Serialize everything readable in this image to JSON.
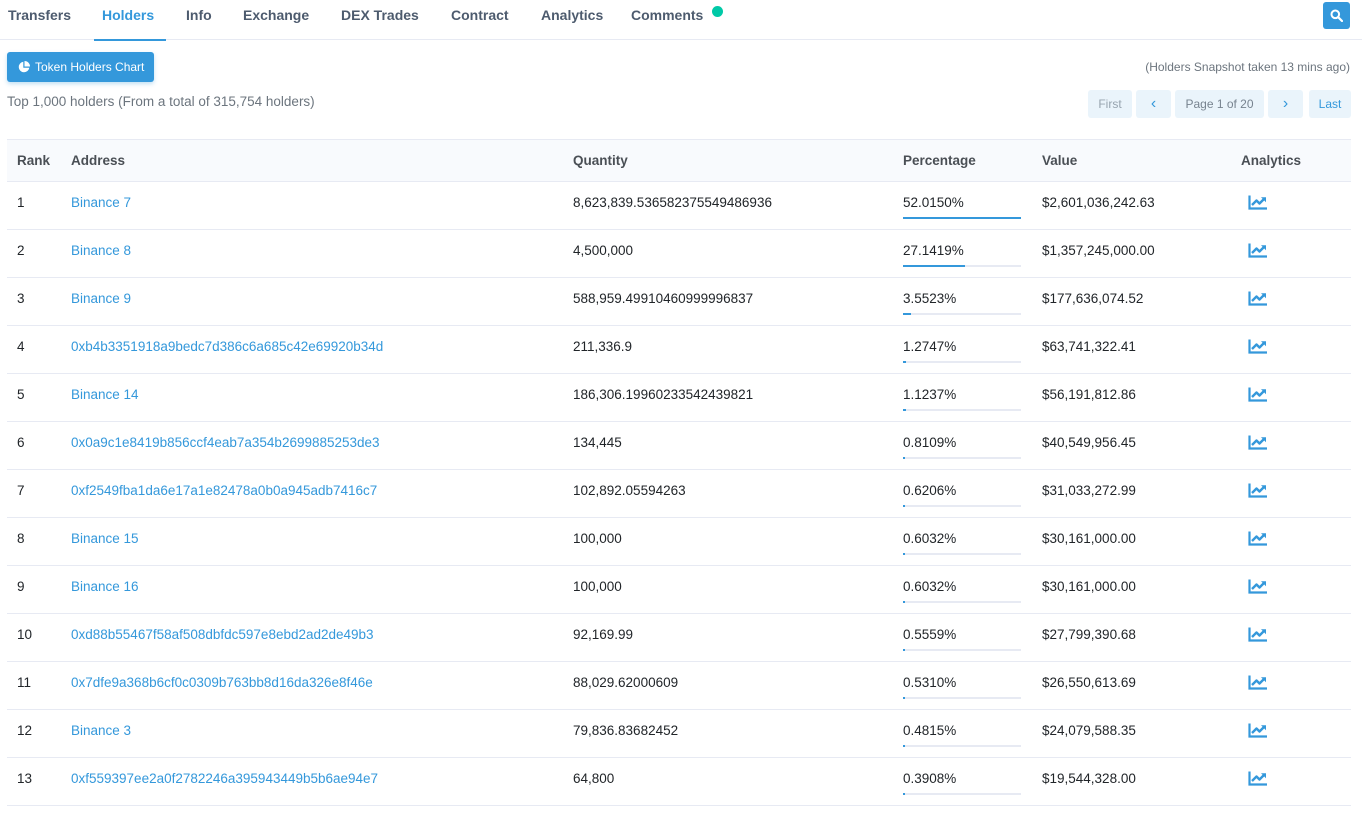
{
  "tabs": [
    {
      "label": "Transfers"
    },
    {
      "label": "Holders"
    },
    {
      "label": "Info"
    },
    {
      "label": "Exchange"
    },
    {
      "label": "DEX Trades"
    },
    {
      "label": "Contract"
    },
    {
      "label": "Analytics"
    },
    {
      "label": "Comments"
    }
  ],
  "active_tab": "Holders",
  "chart_button_label": "Token Holders Chart",
  "snapshot_text": "(Holders Snapshot taken 13 mins ago)",
  "summary_text": "Top 1,000 holders (From a total of 315,754 holders)",
  "pagination": {
    "first": "First",
    "prev": "‹",
    "page_info": "Page 1 of 20",
    "next": "›",
    "last": "Last"
  },
  "table": {
    "headers": {
      "rank": "Rank",
      "address": "Address",
      "quantity": "Quantity",
      "percentage": "Percentage",
      "value": "Value",
      "analytics": "Analytics"
    },
    "rows": [
      {
        "rank": "1",
        "address": "Binance 7",
        "quantity": "8,623,839.536582375549486936",
        "percentage": "52.0150%",
        "pct": 52.015,
        "value": "$2,601,036,242.63"
      },
      {
        "rank": "2",
        "address": "Binance 8",
        "quantity": "4,500,000",
        "percentage": "27.1419%",
        "pct": 27.1419,
        "value": "$1,357,245,000.00"
      },
      {
        "rank": "3",
        "address": "Binance 9",
        "quantity": "588,959.49910460999996837",
        "percentage": "3.5523%",
        "pct": 3.5523,
        "value": "$177,636,074.52"
      },
      {
        "rank": "4",
        "address": "0xb4b3351918a9bedc7d386c6a685c42e69920b34d",
        "quantity": "211,336.9",
        "percentage": "1.2747%",
        "pct": 1.2747,
        "value": "$63,741,322.41"
      },
      {
        "rank": "5",
        "address": "Binance 14",
        "quantity": "186,306.19960233542439821",
        "percentage": "1.1237%",
        "pct": 1.1237,
        "value": "$56,191,812.86"
      },
      {
        "rank": "6",
        "address": "0x0a9c1e8419b856ccf4eab7a354b2699885253de3",
        "quantity": "134,445",
        "percentage": "0.8109%",
        "pct": 0.8109,
        "value": "$40,549,956.45"
      },
      {
        "rank": "7",
        "address": "0xf2549fba1da6e17a1e82478a0b0a945adb7416c7",
        "quantity": "102,892.05594263",
        "percentage": "0.6206%",
        "pct": 0.6206,
        "value": "$31,033,272.99"
      },
      {
        "rank": "8",
        "address": "Binance 15",
        "quantity": "100,000",
        "percentage": "0.6032%",
        "pct": 0.6032,
        "value": "$30,161,000.00"
      },
      {
        "rank": "9",
        "address": "Binance 16",
        "quantity": "100,000",
        "percentage": "0.6032%",
        "pct": 0.6032,
        "value": "$30,161,000.00"
      },
      {
        "rank": "10",
        "address": "0xd88b55467f58af508dbfdc597e8ebd2ad2de49b3",
        "quantity": "92,169.99",
        "percentage": "0.5559%",
        "pct": 0.5559,
        "value": "$27,799,390.68"
      },
      {
        "rank": "11",
        "address": "0x7dfe9a368b6cf0c0309b763bb8d16da326e8f46e",
        "quantity": "88,029.62000609",
        "percentage": "0.5310%",
        "pct": 0.531,
        "value": "$26,550,613.69"
      },
      {
        "rank": "12",
        "address": "Binance 3",
        "quantity": "79,836.83682452",
        "percentage": "0.4815%",
        "pct": 0.4815,
        "value": "$24,079,588.35"
      },
      {
        "rank": "13",
        "address": "0xf559397ee2a0f2782246a395943449b5b6ae94e7",
        "quantity": "64,800",
        "percentage": "0.3908%",
        "pct": 0.3908,
        "value": "$19,544,328.00"
      }
    ]
  },
  "colors": {
    "accent": "#3498db",
    "notification_dot": "#00c9a7"
  },
  "icons": {
    "search": "search-icon",
    "chart_button": "pie-chart-icon",
    "row_analytics": "chart-line-icon"
  }
}
